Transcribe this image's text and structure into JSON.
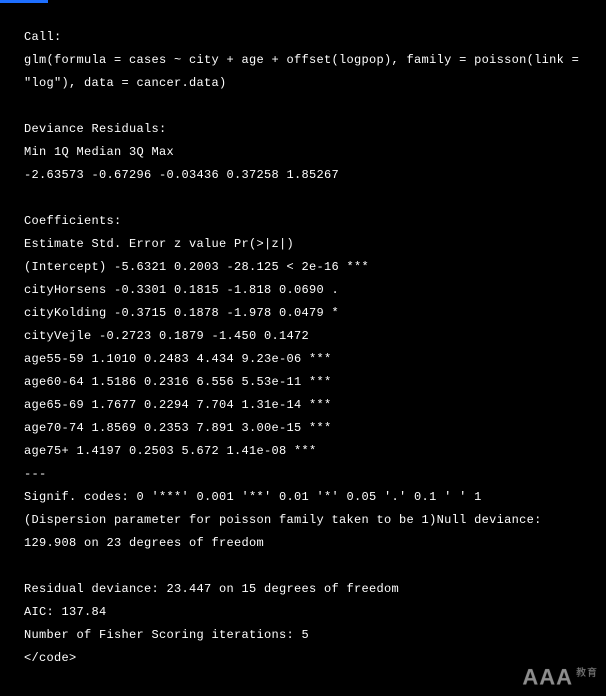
{
  "lines": [
    "Call:",
    "glm(formula = cases ~ city + age + offset(logpop), family = poisson(link =",
    "\"log\"), data = cancer.data)",
    "",
    "Deviance Residuals:",
    "Min 1Q Median 3Q Max",
    "-2.63573 -0.67296 -0.03436 0.37258 1.85267",
    "",
    "Coefficients:",
    "Estimate Std. Error z value Pr(>|z|)",
    "(Intercept) -5.6321 0.2003 -28.125 < 2e-16 ***",
    "cityHorsens -0.3301 0.1815 -1.818 0.0690 .",
    "cityKolding -0.3715 0.1878 -1.978 0.0479 *",
    "cityVejle -0.2723 0.1879 -1.450 0.1472",
    "age55-59 1.1010 0.2483 4.434 9.23e-06 ***",
    "age60-64 1.5186 0.2316 6.556 5.53e-11 ***",
    "age65-69 1.7677 0.2294 7.704 1.31e-14 ***",
    "age70-74 1.8569 0.2353 7.891 3.00e-15 ***",
    "age75+ 1.4197 0.2503 5.672 1.41e-08 ***",
    "---",
    "Signif. codes: 0 '***' 0.001 '**' 0.01 '*' 0.05 '.' 0.1 ' ' 1",
    "(Dispersion parameter for poisson family taken to be 1)Null deviance:",
    "129.908 on 23 degrees of freedom",
    "",
    "Residual deviance: 23.447 on 15 degrees of freedom",
    "AIC: 137.84",
    "Number of Fisher Scoring iterations: 5",
    "</code>"
  ],
  "watermark": {
    "main": "AAA",
    "sub": "教育"
  }
}
